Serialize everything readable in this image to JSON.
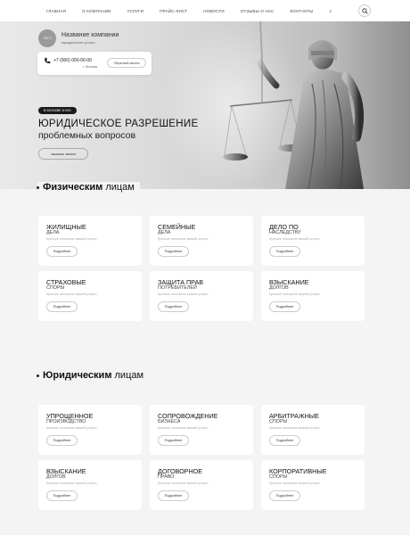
{
  "nav": {
    "items": [
      "Главная",
      "О компании",
      "Услуги",
      "Прайс-лист",
      "Новости",
      "Отзывы о нас",
      "Контакты"
    ],
    "more": "≡"
  },
  "company": {
    "logo_text": "ЛОГО",
    "name": "Название компании",
    "subtitle": "юридические услуги"
  },
  "contact": {
    "phone": "+7 (000) 000-00-00",
    "city": "г. Москва",
    "callback_label": "Обратный звонок"
  },
  "hero": {
    "tag": "В МОСКВЕ И МО",
    "title_line1": "ЮРИДИЧЕСКОЕ РАЗРЕШЕНИЕ",
    "title_line2": "проблемных вопросов",
    "cta": "заказать звонок"
  },
  "individuals": {
    "title_bold": "Физическим",
    "title_rest": " лицам",
    "cards": [
      {
        "title1": "ЖИЛИЩНЫЕ",
        "title2": "ДЕЛА",
        "desc": "Краткое описание вашей услуги",
        "button": "Подробнее"
      },
      {
        "title1": "СЕМЕЙНЫЕ",
        "title2": "ДЕЛА",
        "desc": "Краткое описание вашей услуги",
        "button": "Подробнее"
      },
      {
        "title1": "ДЕЛО ПО",
        "title2": "НАСЛЕДСТВУ",
        "desc": "Краткое описание вашей услуги",
        "button": "Подробнее"
      },
      {
        "title1": "СТРАХОВЫЕ",
        "title2": "СПОРЫ",
        "desc": "Краткое описание вашей услуги",
        "button": "Подробнее"
      },
      {
        "title1": "ЗАЩИТА ПРАВ",
        "title2": "ПОТРЕБИТЕЛЕЙ",
        "desc": "Краткое описание вашей услуги",
        "button": "Подробнее"
      },
      {
        "title1": "ВЗЫСКАНИЕ",
        "title2": "ДОЛГОВ",
        "desc": "Краткое описание вашей услуги",
        "button": "Подробнее"
      }
    ]
  },
  "legal": {
    "title_bold": "Юридическим",
    "title_rest": " лицам",
    "cards": [
      {
        "title1": "УПРОЩЕННОЕ",
        "title2": "ПРОИЗВОДСТВО",
        "desc": "Краткое описание вашей услуги",
        "button": "Подробнее"
      },
      {
        "title1": "СОПРОВОЖДЕНИЕ",
        "title2": "БИЗНЕСА",
        "desc": "Краткое описание вашей услуги",
        "button": "Подробнее"
      },
      {
        "title1": "АРБИТРАЖНЫЕ",
        "title2": "СПОРЫ",
        "desc": "Краткое описание вашей услуги",
        "button": "Подробнее"
      },
      {
        "title1": "ВЗЫСКАНИЕ",
        "title2": "ДОЛГОВ",
        "desc": "Краткое описание вашей услуги",
        "button": "Подробнее"
      },
      {
        "title1": "ДОГОВОРНОЕ",
        "title2": "ПРАВО",
        "desc": "Краткое описание вашей услуги",
        "button": "Подробнее"
      },
      {
        "title1": "КОРПОРАТИВНЫЕ",
        "title2": "СПОРЫ",
        "desc": "Краткое описание вашей услуги",
        "button": "Подробнее"
      }
    ]
  }
}
